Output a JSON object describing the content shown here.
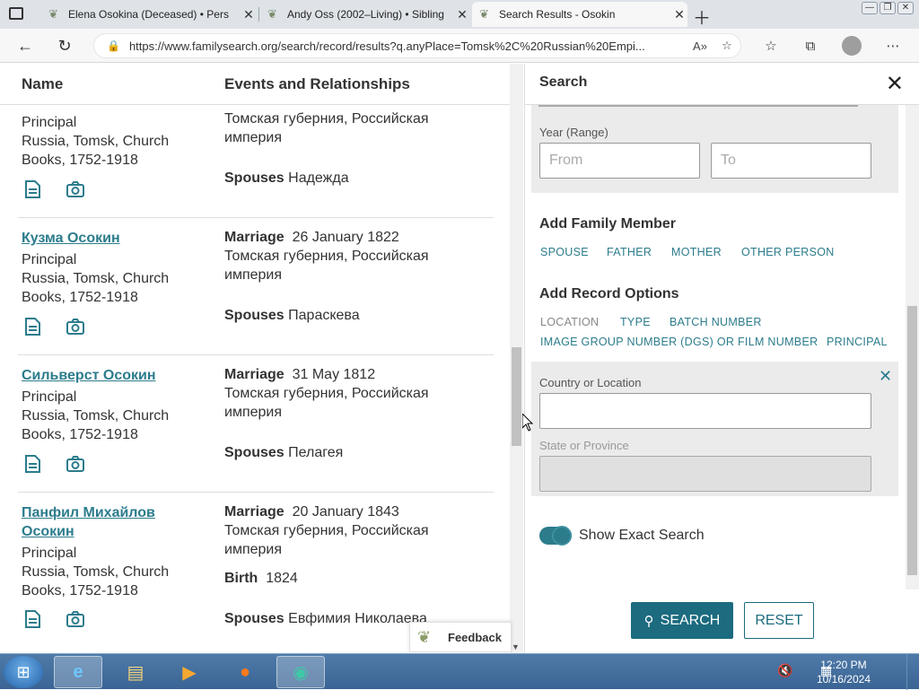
{
  "browser": {
    "tabs": [
      {
        "title": "Elena Osokina (Deceased) • Pers",
        "active": false
      },
      {
        "title": "Andy Oss (2002–Living) • Sibling",
        "active": false
      },
      {
        "title": "Search Results - Osokin",
        "active": true
      }
    ],
    "url": "https://www.familysearch.org/search/record/results?q.anyPlace=Tomsk%2C%20Russian%20Empi..."
  },
  "results": {
    "col_name": "Name",
    "col_events": "Events and Relationships",
    "top_partial": {
      "role": "Principal",
      "collection": [
        "Russia, Tomsk, Church",
        "Books, 1752-1918"
      ],
      "place": [
        "Томская губерния, Российская",
        "империя"
      ],
      "spouses_label": "Spouses",
      "spouses": "Надежда"
    },
    "rows": [
      {
        "name": [
          "Кузма Осокин"
        ],
        "role": "Principal",
        "collection": [
          "Russia, Tomsk, Church",
          "Books, 1752-1918"
        ],
        "event_label": "Marriage",
        "event_date": "26 January 1822",
        "place": [
          "Томская губерния, Российская",
          "империя"
        ],
        "spouses_label": "Spouses",
        "spouses": "Параскева"
      },
      {
        "name": [
          "Сильверст Осокин"
        ],
        "role": "Principal",
        "collection": [
          "Russia, Tomsk, Church",
          "Books, 1752-1918"
        ],
        "event_label": "Marriage",
        "event_date": "31 May 1812",
        "place": [
          "Томская губерния, Российская",
          "империя"
        ],
        "spouses_label": "Spouses",
        "spouses": "Пелагея"
      },
      {
        "name": [
          "Панфил Михайлов",
          "Осокин"
        ],
        "role": "Principal",
        "collection": [
          "Russia, Tomsk, Church",
          "Books, 1752-1918"
        ],
        "event_label": "Marriage",
        "event_date": "20 January 1843",
        "place": [
          "Томская губерния, Российская",
          "империя"
        ],
        "birth_label": "Birth",
        "birth_date": "1824",
        "spouses_label": "Spouses",
        "spouses": "Евфимия Николаева"
      }
    ],
    "feedback": "Feedback"
  },
  "search_panel": {
    "title": "Search",
    "year_range_label": "Year (Range)",
    "from_placeholder": "From",
    "to_placeholder": "To",
    "add_family_title": "Add Family Member",
    "family_links": [
      "SPOUSE",
      "FATHER",
      "MOTHER",
      "OTHER PERSON"
    ],
    "add_record_title": "Add Record Options",
    "record_links": [
      "LOCATION",
      "TYPE",
      "BATCH NUMBER",
      "IMAGE GROUP NUMBER (DGS) OR FILM NUMBER",
      "PRINCIPAL"
    ],
    "country_label": "Country or Location",
    "state_label": "State or Province",
    "show_exact_label": "Show Exact Search",
    "show_exact_on": true,
    "search_button": "SEARCH",
    "reset_button": "RESET"
  },
  "taskbar": {
    "time": "12:20 PM",
    "date": "10/16/2024"
  },
  "colors": {
    "accent": "#2c7c8c",
    "search_button": "#1c6b7f",
    "panel_gray": "#ebebeb"
  }
}
